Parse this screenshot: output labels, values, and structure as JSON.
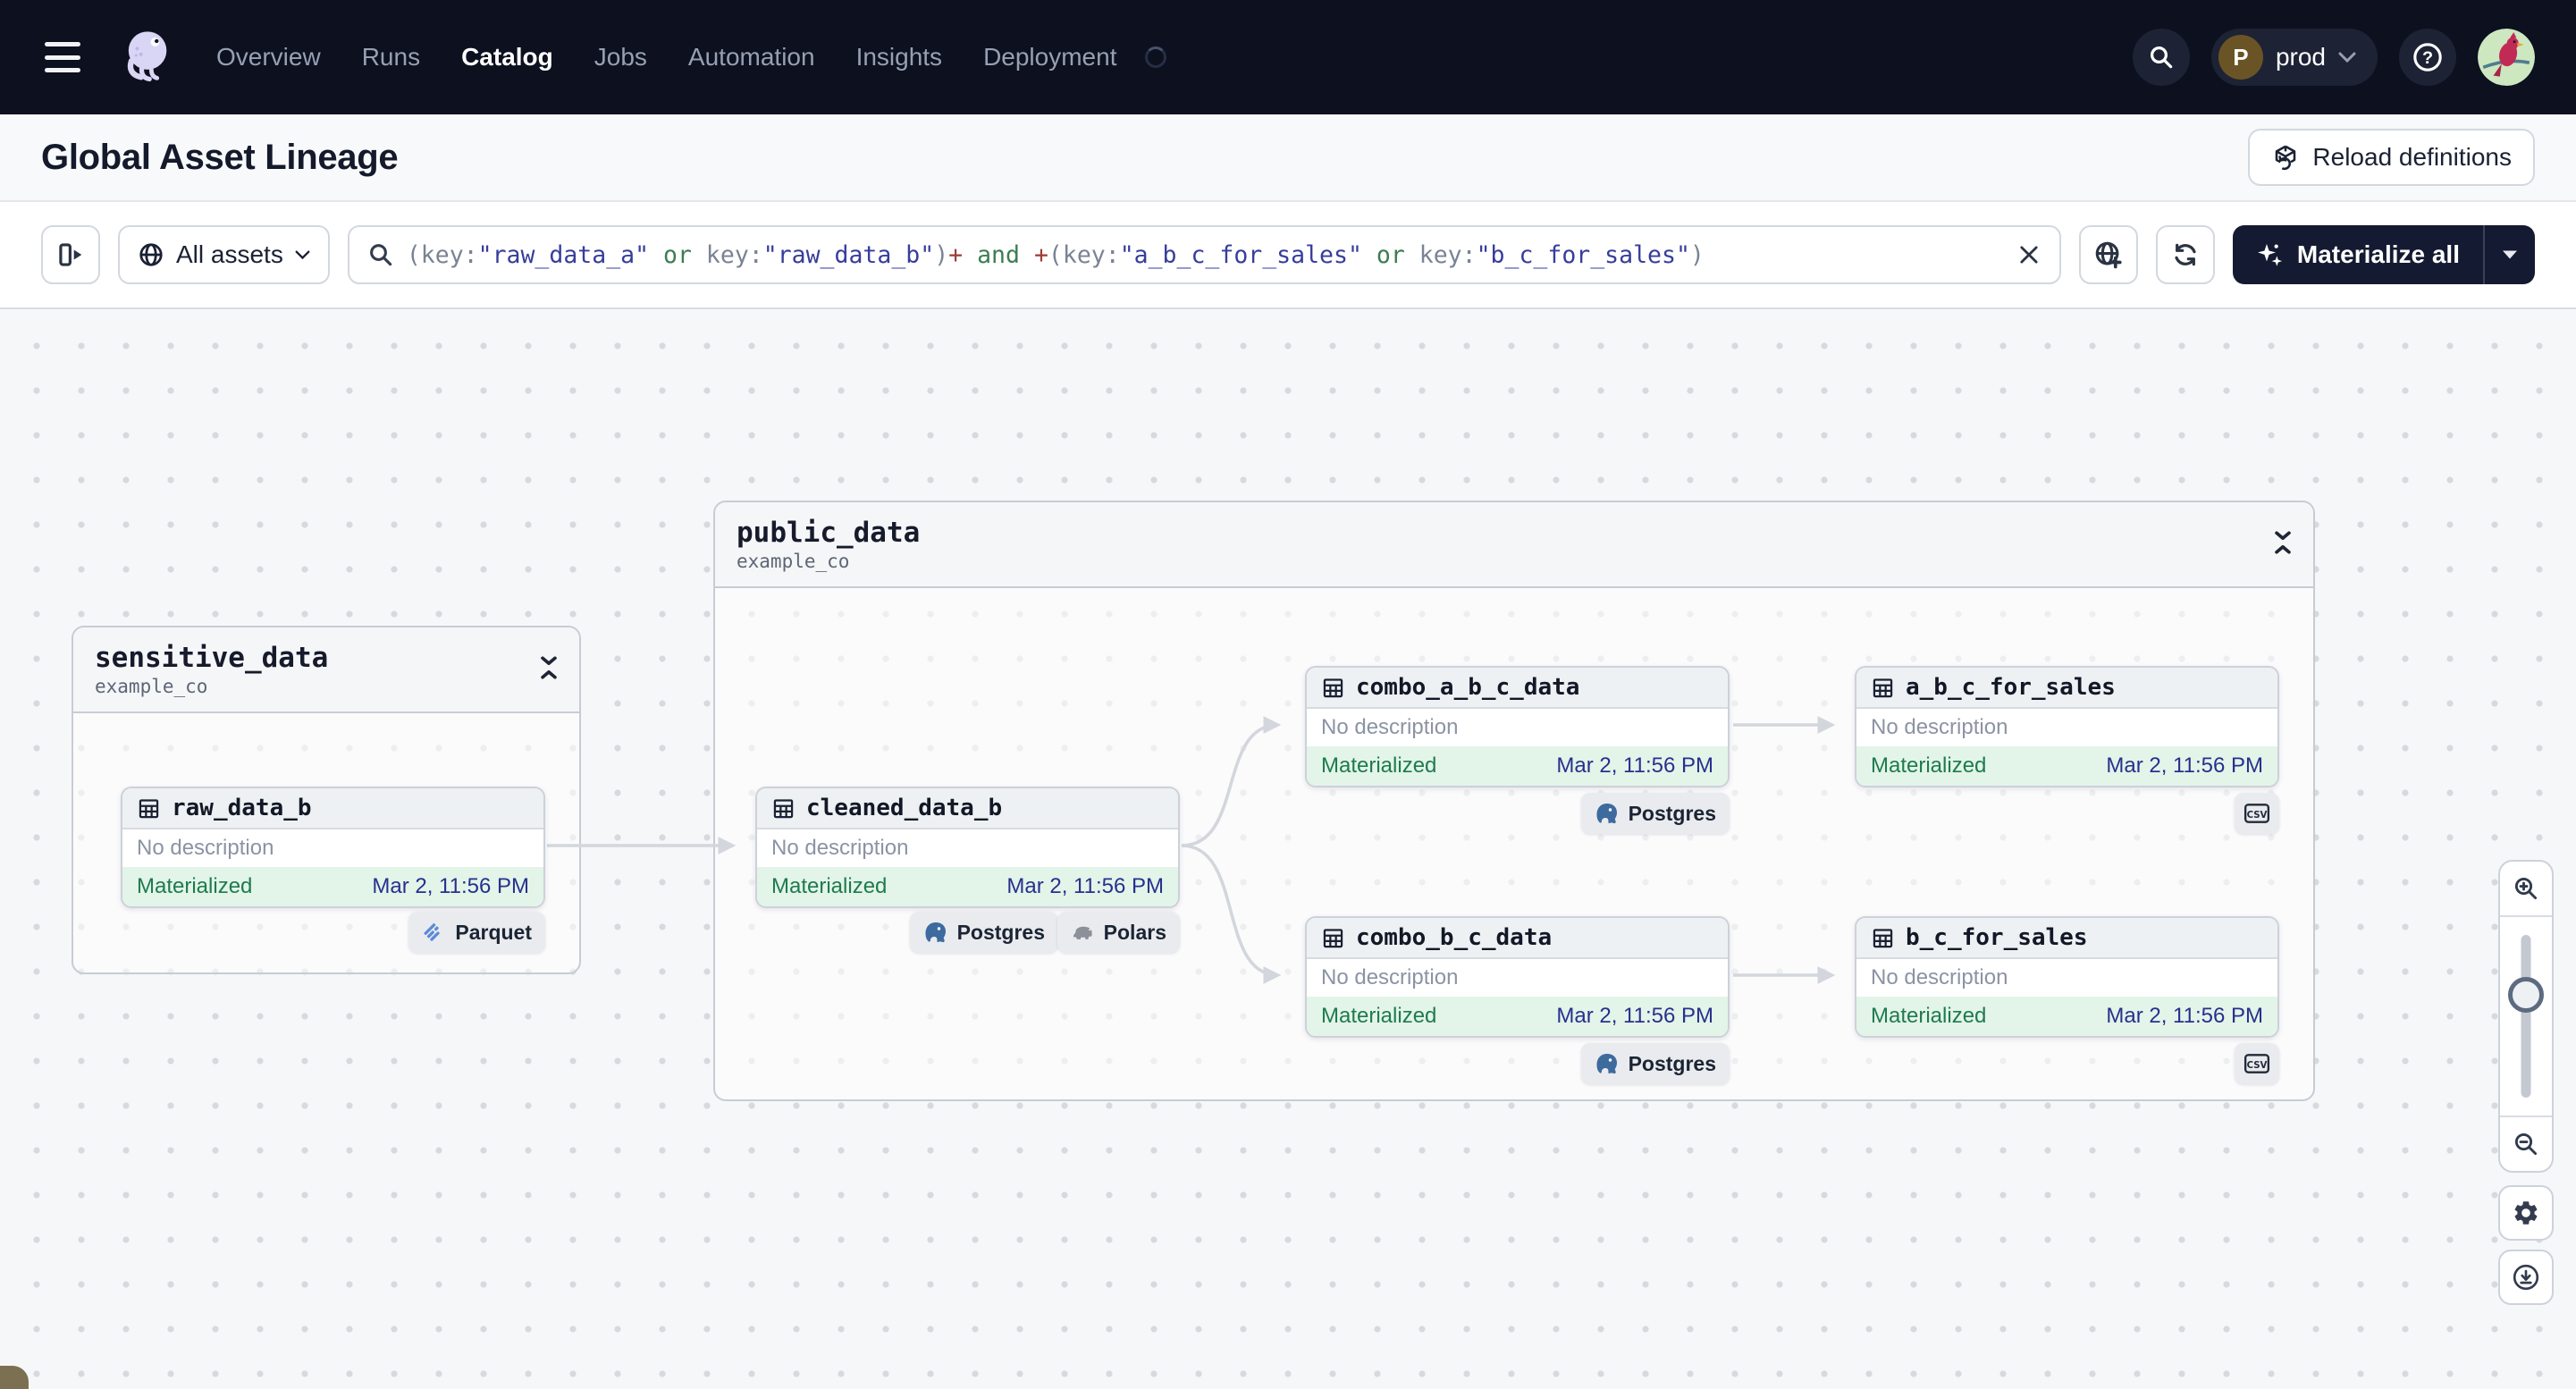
{
  "nav": {
    "links": [
      "Overview",
      "Runs",
      "Catalog",
      "Jobs",
      "Automation",
      "Insights",
      "Deployment"
    ],
    "active_link": "Catalog",
    "deployment": {
      "initial": "P",
      "name": "prod"
    }
  },
  "page_header": {
    "title": "Global Asset Lineage",
    "reload_button": "Reload definitions"
  },
  "filter_bar": {
    "scope_button": "All assets",
    "materialize_button": "Materialize all",
    "query_segments": [
      {
        "t": "(key:",
        "c": "p"
      },
      {
        "t": "\"raw_data_a\"",
        "c": "s"
      },
      {
        "t": " ",
        "c": "p"
      },
      {
        "t": "or",
        "c": "k"
      },
      {
        "t": " key:",
        "c": "p"
      },
      {
        "t": "\"raw_data_b\"",
        "c": "s"
      },
      {
        "t": ")",
        "c": "p"
      },
      {
        "t": "+",
        "c": "r"
      },
      {
        "t": " ",
        "c": "p"
      },
      {
        "t": "and",
        "c": "k"
      },
      {
        "t": " ",
        "c": "p"
      },
      {
        "t": "+",
        "c": "r"
      },
      {
        "t": "(key:",
        "c": "p"
      },
      {
        "t": "\"a_b_c_for_sales\"",
        "c": "s"
      },
      {
        "t": " ",
        "c": "p"
      },
      {
        "t": "or",
        "c": "k"
      },
      {
        "t": " key:",
        "c": "p"
      },
      {
        "t": "\"b_c_for_sales\"",
        "c": "s"
      },
      {
        "t": ")",
        "c": "p"
      }
    ]
  },
  "graph": {
    "groups": [
      {
        "name": "sensitive_data",
        "location": "example_co"
      },
      {
        "name": "public_data",
        "location": "example_co"
      }
    ],
    "assets": [
      {
        "name": "raw_data_b",
        "description": "No description",
        "status": "Materialized",
        "timestamp": "Mar 2, 11:56 PM"
      },
      {
        "name": "cleaned_data_b",
        "description": "No description",
        "status": "Materialized",
        "timestamp": "Mar 2, 11:56 PM"
      },
      {
        "name": "combo_a_b_c_data",
        "description": "No description",
        "status": "Materialized",
        "timestamp": "Mar 2, 11:56 PM"
      },
      {
        "name": "a_b_c_for_sales",
        "description": "No description",
        "status": "Materialized",
        "timestamp": "Mar 2, 11:56 PM"
      },
      {
        "name": "combo_b_c_data",
        "description": "No description",
        "status": "Materialized",
        "timestamp": "Mar 2, 11:56 PM"
      },
      {
        "name": "b_c_for_sales",
        "description": "No description",
        "status": "Materialized",
        "timestamp": "Mar 2, 11:56 PM"
      }
    ],
    "tags": {
      "parquet": "Parquet",
      "postgres": "Postgres",
      "polars": "Polars",
      "csv": "CSV"
    }
  },
  "colors": {
    "nav_bg": "#0c101f",
    "materialize_bg": "#141a31",
    "status_green": "#1e7b4d",
    "timestamp_blue": "#28308d",
    "query_string": "#373d9c",
    "query_keyword": "#3c7d52",
    "query_plus": "#9d3b34",
    "edge_gray": "#d3d6dc"
  }
}
